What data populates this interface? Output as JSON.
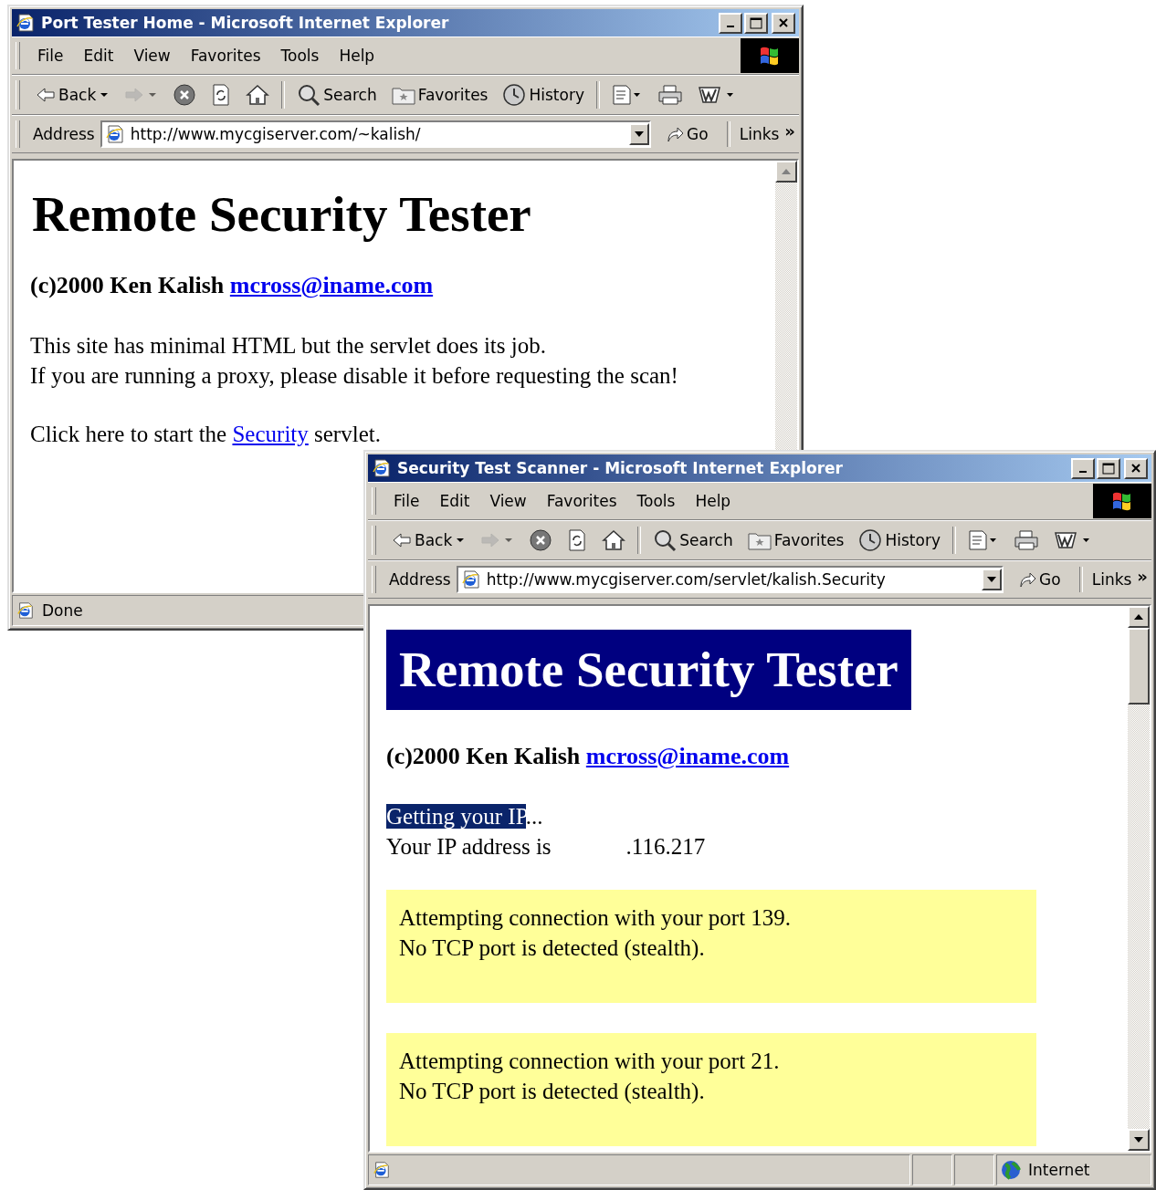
{
  "windows": [
    {
      "title": "Port Tester Home - Microsoft Internet Explorer",
      "menu": [
        "File",
        "Edit",
        "View",
        "Favorites",
        "Tools",
        "Help"
      ],
      "toolbar": [
        {
          "kind": "back",
          "label": "Back",
          "disabled": false
        },
        {
          "kind": "forward",
          "disabled": true
        },
        {
          "kind": "stop",
          "disabled": false
        },
        {
          "kind": "refresh",
          "disabled": false
        },
        {
          "kind": "home",
          "disabled": false
        },
        {
          "kind": "search",
          "label": "Search",
          "disabled": false
        },
        {
          "kind": "favorites",
          "label": "Favorites",
          "disabled": false
        },
        {
          "kind": "history",
          "label": "History",
          "disabled": false
        },
        {
          "kind": "mail",
          "disabled": false
        },
        {
          "kind": "print",
          "disabled": false
        },
        {
          "kind": "edit",
          "disabled": false
        }
      ],
      "address": {
        "label": "Address",
        "url": "http://www.mycgiserver.com/~kalish/"
      },
      "go": "Go",
      "links": "Links",
      "links_more": "»",
      "scrollable": false,
      "content": [
        {
          "kind": "heading",
          "text": "Remote Security Tester"
        },
        {
          "kind": "byline",
          "text": "(c)2000 Ken Kalish",
          "link": "mcross@iname.com"
        },
        {
          "kind": "lines",
          "lines": [
            "This site has minimal HTML but the servlet does its job.",
            "If you are running a proxy, please disable it before requesting the scan!"
          ]
        },
        {
          "kind": "link_line",
          "before": "Click here to start the",
          "link": "Security",
          "after": "servlet."
        }
      ],
      "status": {
        "text": "Done"
      }
    },
    {
      "title": "Security Test Scanner - Microsoft Internet Explorer",
      "menu": [
        "File",
        "Edit",
        "View",
        "Favorites",
        "Tools",
        "Help"
      ],
      "toolbar": [
        {
          "kind": "back",
          "label": "Back",
          "disabled": false
        },
        {
          "kind": "forward",
          "disabled": true
        },
        {
          "kind": "stop",
          "disabled": false
        },
        {
          "kind": "refresh",
          "disabled": false
        },
        {
          "kind": "home",
          "disabled": false
        },
        {
          "kind": "search",
          "label": "Search",
          "disabled": false
        },
        {
          "kind": "favorites",
          "label": "Favorites",
          "disabled": false
        },
        {
          "kind": "history",
          "label": "History",
          "disabled": false
        },
        {
          "kind": "mail",
          "disabled": false
        },
        {
          "kind": "print",
          "disabled": false
        },
        {
          "kind": "edit",
          "disabled": false
        }
      ],
      "address": {
        "label": "Address",
        "url": "http://www.mycgiserver.com/servlet/kalish.Security"
      },
      "go": "Go",
      "links": "Links",
      "links_more": "»",
      "scrollable": true,
      "content": [
        {
          "kind": "banner",
          "text": "Remote Security Tester"
        },
        {
          "kind": "byline",
          "text": "(c)2000 Ken Kalish",
          "link": "mcross@iname.com"
        },
        {
          "kind": "progress",
          "highlight": "Getting your IP",
          "rest": "..."
        },
        {
          "kind": "ip",
          "label": "Your IP address is",
          "value": ".116.217"
        },
        {
          "kind": "port_box",
          "lines": [
            "Attempting connection with your port 139.",
            "No TCP port is detected (stealth)."
          ]
        },
        {
          "kind": "port_box",
          "lines": [
            "Attempting connection with your port 21.",
            "No TCP port is detected (stealth)."
          ]
        }
      ],
      "status": {
        "zone": "Internet"
      }
    }
  ]
}
